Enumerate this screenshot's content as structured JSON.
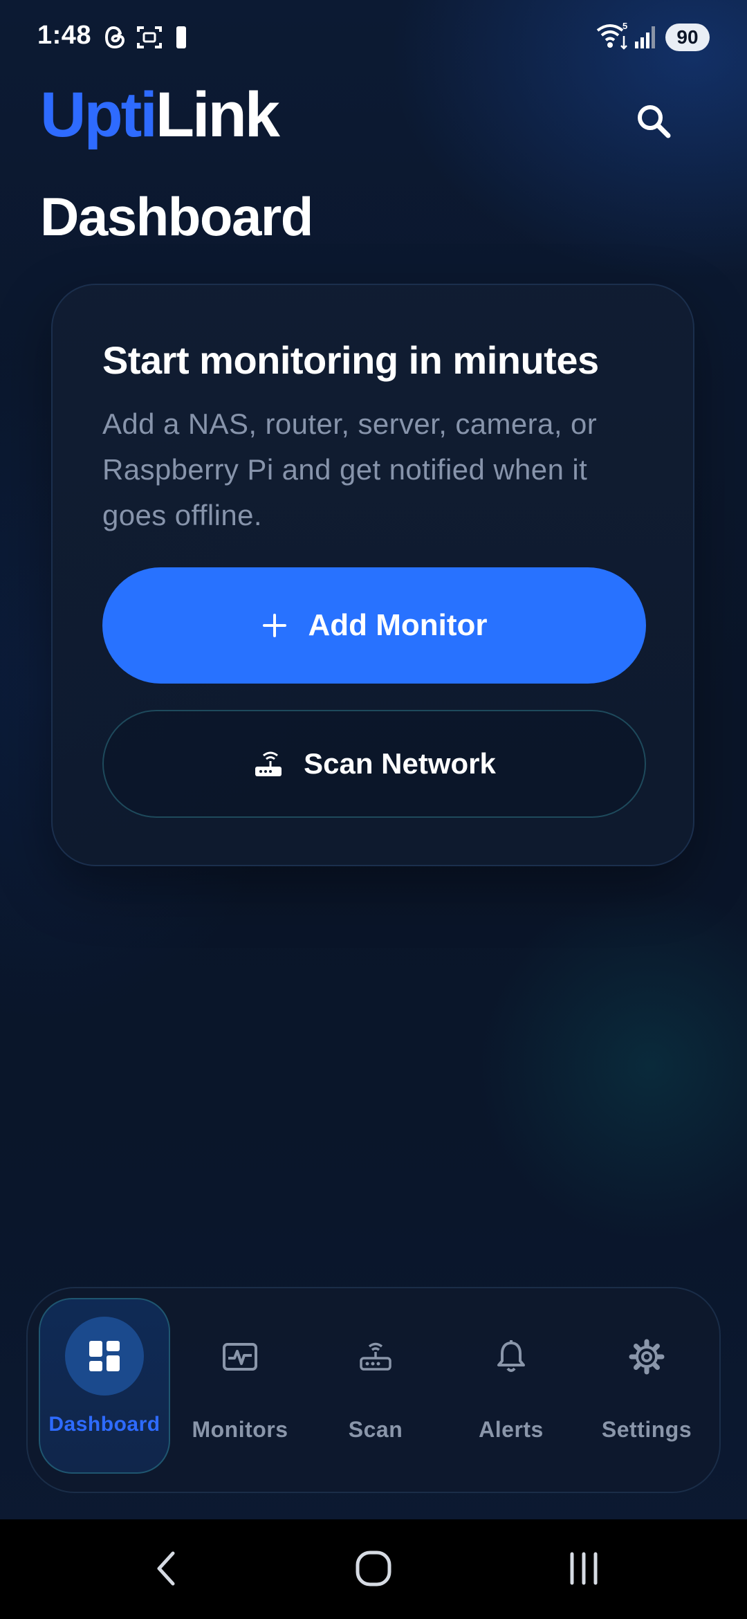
{
  "status_bar": {
    "time": "1:48",
    "battery_level": "90",
    "icons": [
      "threads-icon",
      "screenshot-icon",
      "battery-small-icon",
      "wifi-icon",
      "cellular-signal-icon"
    ]
  },
  "header": {
    "brand_part1": "Upti",
    "brand_part2": "Link",
    "brand_part1_color": "#2e6bff",
    "page_title": "Dashboard"
  },
  "card": {
    "title": "Start monitoring in minutes",
    "description": "Add a NAS, router, server, camera, or Raspberry Pi and get notified when it goes offline.",
    "primary_button": {
      "icon": "plus-icon",
      "label": "Add Monitor",
      "color": "#2872ff"
    },
    "secondary_button": {
      "icon": "router-icon",
      "label": "Scan Network"
    }
  },
  "bottom_nav": {
    "items": [
      {
        "icon": "dashboard-grid-icon",
        "label": "Dashboard",
        "active": true
      },
      {
        "icon": "monitor-pulse-icon",
        "label": "Monitors",
        "active": false
      },
      {
        "icon": "router-scan-icon",
        "label": "Scan",
        "active": false
      },
      {
        "icon": "bell-icon",
        "label": "Alerts",
        "active": false
      },
      {
        "icon": "gear-icon",
        "label": "Settings",
        "active": false
      }
    ]
  },
  "system_nav": {
    "buttons": [
      "back-icon",
      "home-icon",
      "recents-icon"
    ]
  }
}
